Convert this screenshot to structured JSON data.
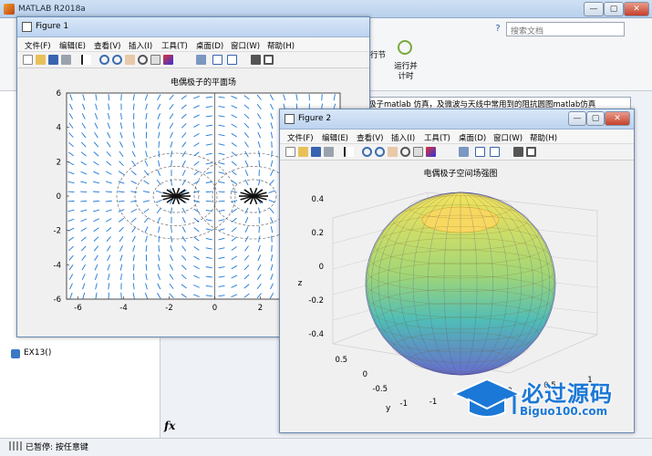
{
  "main": {
    "title": "MATLAB R2018a",
    "search_placeholder": "搜索文档",
    "help": "?",
    "address": "极子matlab 仿真，及微波与天线中常用到的阻抗圆图matlab仿真",
    "toolbar": {
      "run_section": "行节",
      "run_time": "运行并\n计时"
    },
    "left_item": "EX13()",
    "fx": "fx",
    "status": "已暂停: 按任意键"
  },
  "figure1": {
    "title": "Figure 1",
    "menu": [
      "文件(F)",
      "编辑(E)",
      "查看(V)",
      "插入(I)",
      "工具(T)",
      "桌面(D)",
      "窗口(W)",
      "帮助(H)"
    ],
    "plot_title": "电偶极子的平面场",
    "x_ticks": [
      "-6",
      "-4",
      "-2",
      "0",
      "2"
    ],
    "y_ticks": [
      "6",
      "4",
      "2",
      "0",
      "-2",
      "-4",
      "-6"
    ]
  },
  "figure2": {
    "title": "Figure 2",
    "menu": [
      "文件(F)",
      "编辑(E)",
      "查看(V)",
      "插入(I)",
      "工具(T)",
      "桌面(D)",
      "窗口(W)",
      "帮助(H)"
    ],
    "plot_title": "电偶极子空间场强图",
    "z_label": "z",
    "x_label": "x",
    "y_label": "y",
    "z_ticks": [
      "0.4",
      "0.2",
      "0",
      "-0.2",
      "-0.4"
    ],
    "y_ticks": [
      "0.5",
      "0",
      "-0.5",
      "-1"
    ],
    "x_ticks": [
      "-1",
      "-0.5",
      "0",
      "0.5",
      "1"
    ]
  },
  "watermark": {
    "cn": "必过源码",
    "en": "Biguo100.com"
  },
  "colors": {
    "quiver": "#1f77d4",
    "accent": "#2b5ea8",
    "torus_top": "#f5e24a",
    "torus_bottom": "#5a60c8"
  }
}
